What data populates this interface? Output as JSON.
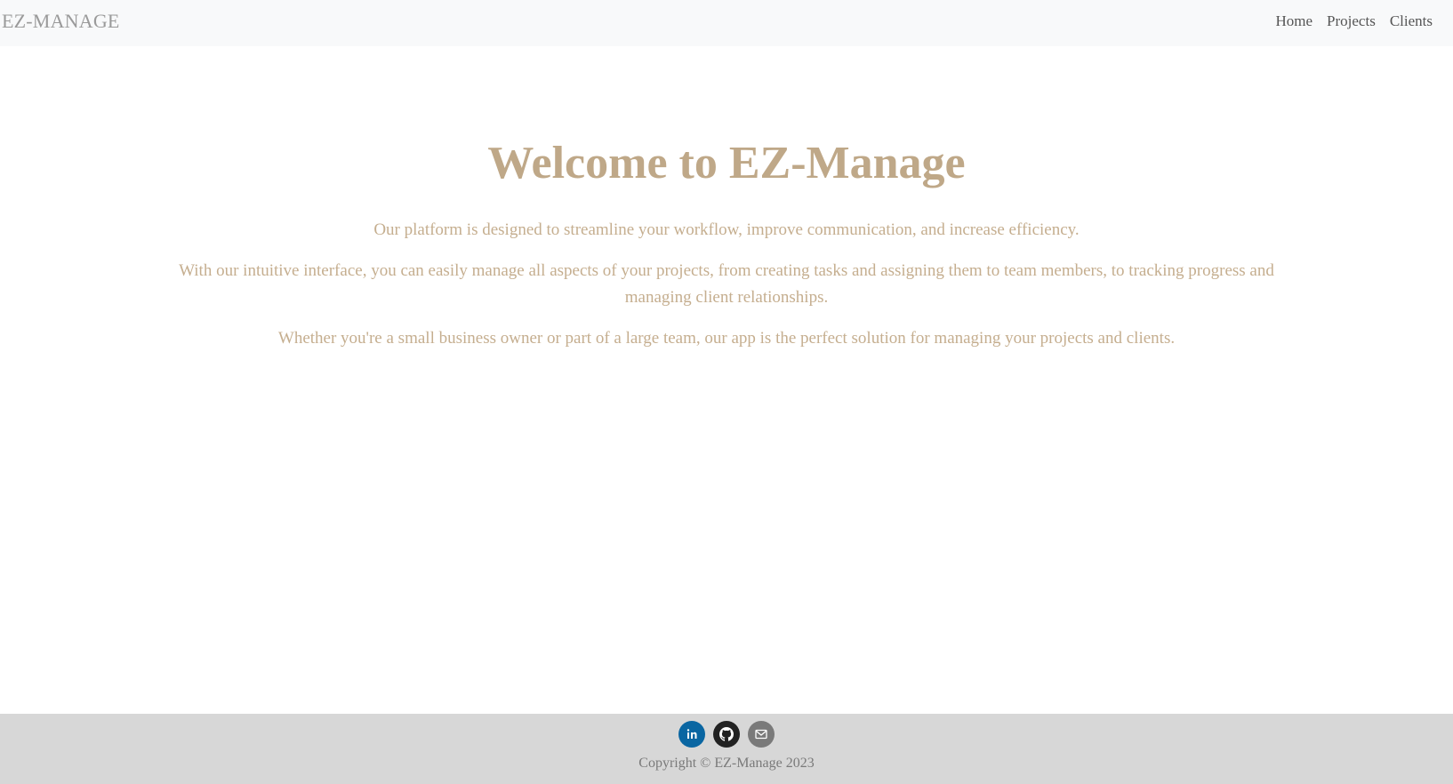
{
  "nav": {
    "brand": "EZ-MANAGE",
    "links": [
      "Home",
      "Projects",
      "Clients"
    ]
  },
  "hero": {
    "title": "Welcome to EZ-Manage",
    "paragraphs": [
      "Our platform is designed to streamline your workflow, improve communication, and increase efficiency.",
      "With our intuitive interface, you can easily manage all aspects of your projects, from creating tasks and assigning them to team members, to tracking progress and managing client relationships.",
      "Whether you're a small business owner or part of a large team, our app is the perfect solution for managing your projects and clients."
    ]
  },
  "footer": {
    "social_icons": [
      "linkedin-icon",
      "github-icon",
      "email-icon"
    ],
    "copyright": "Copyright © EZ-Manage 2023"
  },
  "colors": {
    "navbar_bg": "#f8f9fa",
    "hero_text": "#c2ab8a",
    "footer_bg": "#d7d7d7",
    "linkedin": "#0a66a2",
    "github": "#222222",
    "email": "#7a7a7a"
  }
}
